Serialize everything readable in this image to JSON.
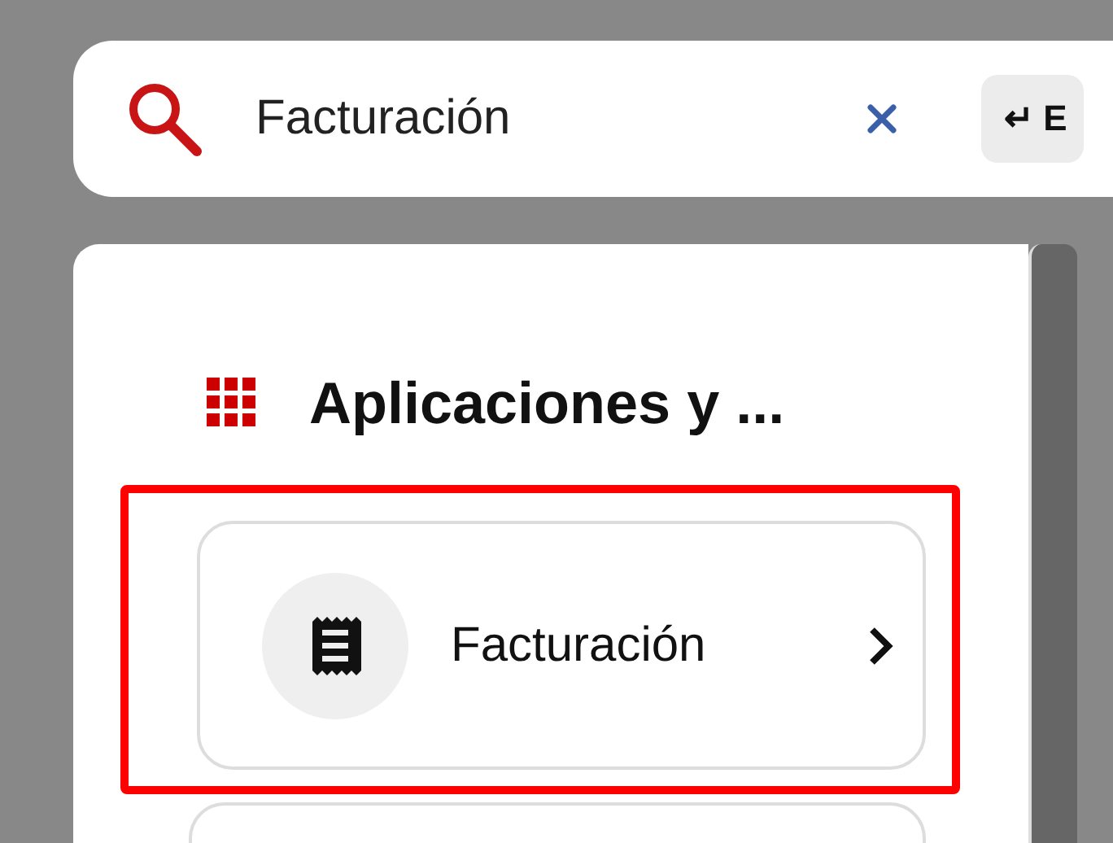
{
  "search": {
    "value": "Facturación",
    "key_hint": "↵ E"
  },
  "section": {
    "title": "Aplicaciones y ...",
    "items": [
      {
        "kind": "app",
        "label": "Facturación",
        "highlighted": true
      },
      {
        "kind": "cut-off",
        "highlighted": false
      }
    ]
  }
}
